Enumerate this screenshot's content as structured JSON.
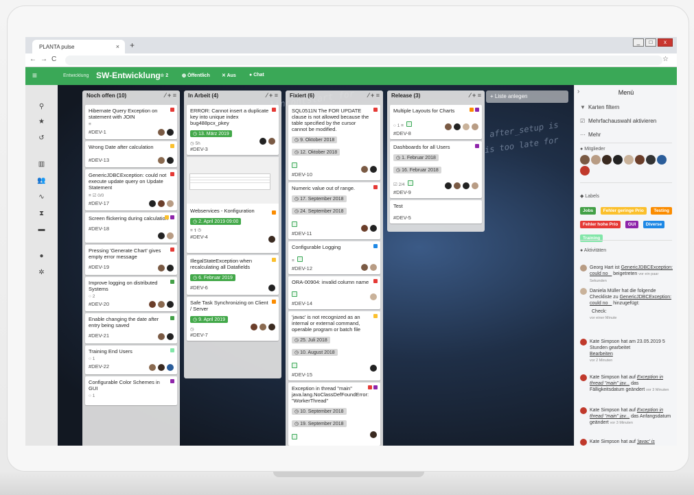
{
  "browser": {
    "tab_title": "PLANTA pulse",
    "tab_close": "×",
    "new_tab": "+",
    "win_min": "_",
    "win_max": "□",
    "win_close": "x",
    "back": "←",
    "forward": "→",
    "reload": "C",
    "star": "☆"
  },
  "header": {
    "menu_icon": "≡",
    "breadcrumb": "Entwicklung",
    "title": "SW-Entwicklung",
    "stars": "☆ 2",
    "visibility": "Öffentlich",
    "notifications": "Aus",
    "chat": "Chat"
  },
  "rail_icons": [
    "search-icon",
    "star-icon",
    "history-icon",
    "board-icon",
    "team-icon",
    "pulse-icon",
    "hourglass-icon",
    "archive-icon",
    "user-icon",
    "settings-icon"
  ],
  "columns": [
    {
      "title": "Noch offen  (10)",
      "cards": [
        {
          "title": "Hibernate Query Exception on statement with JOIN",
          "id": "#DEV-1",
          "meta": "≡",
          "dots": [
            "#e53935"
          ]
        },
        {
          "title": "Wrong Date after calculation",
          "id": "#DEV-13",
          "meta": "",
          "dots": [
            "#fbc02d"
          ]
        },
        {
          "title": "GenericJDBCException: could not execute update query on Update Statement",
          "id": "#DEV-17",
          "meta": "≡ ☑ 0/0",
          "dots": [
            "#e53935"
          ]
        },
        {
          "title": "Screen flickering during calculation",
          "id": "#DEV-18",
          "meta": "",
          "dots": [
            "#fbc02d",
            "#8e24aa"
          ]
        },
        {
          "title": "Pressing 'Generate Chart' gives empty error message",
          "id": "#DEV-19",
          "meta": "",
          "dots": [
            "#e53935"
          ]
        },
        {
          "title": "Improve logging on distributed Systems",
          "id": "#DEV-20",
          "meta": "○ 2",
          "dots": [
            "#43a047"
          ]
        },
        {
          "title": "Enable changing the date after entry being saved",
          "id": "#DEV-21",
          "meta": "",
          "dots": [
            "#43a047"
          ]
        },
        {
          "title": "Training End Users",
          "id": "#DEV-22",
          "meta": "○ 1",
          "dots": [
            "#81e6a8"
          ]
        },
        {
          "title": "Configurable Color Schemes in GUI",
          "id": "",
          "meta": "○ 1",
          "dots": [
            "#8e24aa"
          ]
        }
      ]
    },
    {
      "title": "In Arbeit  (4)",
      "cards": [
        {
          "title": "ERROR: Cannot insert a duplicate key into unique index bug488pcx_pkey",
          "id": "#DEV-3",
          "date": "13. März 2019",
          "meta": "◷ 5h",
          "dots": [
            "#e53935"
          ]
        },
        {
          "title": "Webservices - Konfiguration",
          "id": "#DEV-4",
          "date": "2. April 2019 09:00",
          "meta": "≡ 𝟏 ◷",
          "dots": [
            "#fb8c00"
          ]
        },
        {
          "title": "IllegalStateException when recalculating all Datafields",
          "id": "#DEV-6",
          "date": "6. Februar 2019",
          "meta": "",
          "dots": [
            "#fbc02d"
          ]
        },
        {
          "title": "Safe Task Synchronizing on Client / Server",
          "id": "#DEV-7",
          "date": "9. April 2019",
          "meta": "◷",
          "dots": [
            "#fb8c00"
          ]
        }
      ]
    },
    {
      "title": "Fixiert  (6)",
      "cards": [
        {
          "title": "SQL0511N The FOR UPDATE clause is not allowed because the table specified by the cursor cannot be modified.",
          "id": "#DEV-10",
          "dates": [
            "9. Oktober 2018",
            "12. Oktober 2018"
          ],
          "dots": [
            "#e53935"
          ]
        },
        {
          "title": "Numeric value out of range.",
          "id": "#DEV-11",
          "dates": [
            "17. September 2018",
            "24. September 2018"
          ],
          "dots": [
            "#e53935"
          ]
        },
        {
          "title": "Configurable Logging",
          "id": "#DEV-12",
          "dates": [],
          "dots": [
            "#1e88e5"
          ]
        },
        {
          "title": "ORA-00904: invalid column name",
          "id": "#DEV-14",
          "dates": [],
          "dots": [
            "#e53935"
          ]
        },
        {
          "title": "'javac' is not recognized as an internal or external command, operable program or batch file",
          "id": "#DEV-15",
          "dates": [
            "25. Juli 2018",
            "10. August 2018"
          ],
          "dots": [
            "#fbc02d"
          ]
        },
        {
          "title": "Exception in thread \"main\" java.lang.NoClassDefFoundError: \"WorkerThread\"",
          "id": "",
          "dates": [
            "10. September 2018",
            "19. September 2018"
          ],
          "dots": [
            "#e53935",
            "#8e24aa"
          ]
        }
      ]
    },
    {
      "title": "Release  (3)",
      "cards": [
        {
          "title": "Multiple Layouts for Charts",
          "id": "#DEV-8",
          "meta": "○ 1 ≡",
          "dots": [
            "#fb8c00",
            "#8e24aa"
          ]
        },
        {
          "title": "Dashboards for all Users",
          "id": "#DEV-9",
          "dates": [
            "1. Februar 2018",
            "16. Februar 2018"
          ],
          "meta": "☑ 2/4",
          "dots": [
            "#8e24aa"
          ]
        },
        {
          "title": "Test",
          "id": "#DEV-5",
          "meta": "",
          "dots": []
        }
      ]
    }
  ],
  "add_list": "+ Liste anlegen",
  "panel": {
    "title": "Menü",
    "filter": "Karten filtern",
    "multi": "Mehrfachauswahl aktivieren",
    "more": "Mehr",
    "members": "Mitglieder",
    "labels_title": "Labels",
    "labels": [
      {
        "text": "Jobs",
        "color": "#43a047"
      },
      {
        "text": "Fehler geringe Prio",
        "color": "#fbc02d"
      },
      {
        "text": "Testing",
        "color": "#fb8c00"
      },
      {
        "text": "Fehler hohe Prio",
        "color": "#e53935"
      },
      {
        "text": "GUI",
        "color": "#8e24aa"
      },
      {
        "text": "Diverse",
        "color": "#1e88e5"
      },
      {
        "text": "Training",
        "color": "#81e6a8"
      }
    ],
    "activities_title": "Aktivitäten",
    "activities": [
      {
        "text": "Georg Hart ist",
        "link": "GenericJDBCException: could no _",
        "tail": "beigetreten",
        "time": "vor ein paar Sekunden"
      },
      {
        "text": "Daniela Müller hat die folgende Checkliste zu",
        "link": "GenericJDBCException: could no _",
        "tail": "hinzugefügt:",
        "extra": "Check",
        "time": "vor einer Minute"
      },
      {
        "text": "Kate Simpson hat am 23.05.2019 5 Stunden gearbeitet",
        "link": "Bearbeiten",
        "tail": "",
        "time": "vor 2 Minuten"
      },
      {
        "text": "Kate Simpson hat auf",
        "link": "Exception in thread \"main\" jav...",
        "tail": "das Fälligkeitsdatum geändert",
        "time": "vor 3 Minuten"
      },
      {
        "text": "Kate Simpson hat auf",
        "link": "Exception in thread \"main\" jav...",
        "tail": "das Anfangsdatum geändert",
        "time": "vor 3 Minuten"
      },
      {
        "text": "Kate Simpson hat auf",
        "link": "'javac' is",
        "tail": "",
        "time": ""
      }
    ]
  },
  "colors": {
    "brand": "#3aa857",
    "date_green": "#42a849"
  }
}
